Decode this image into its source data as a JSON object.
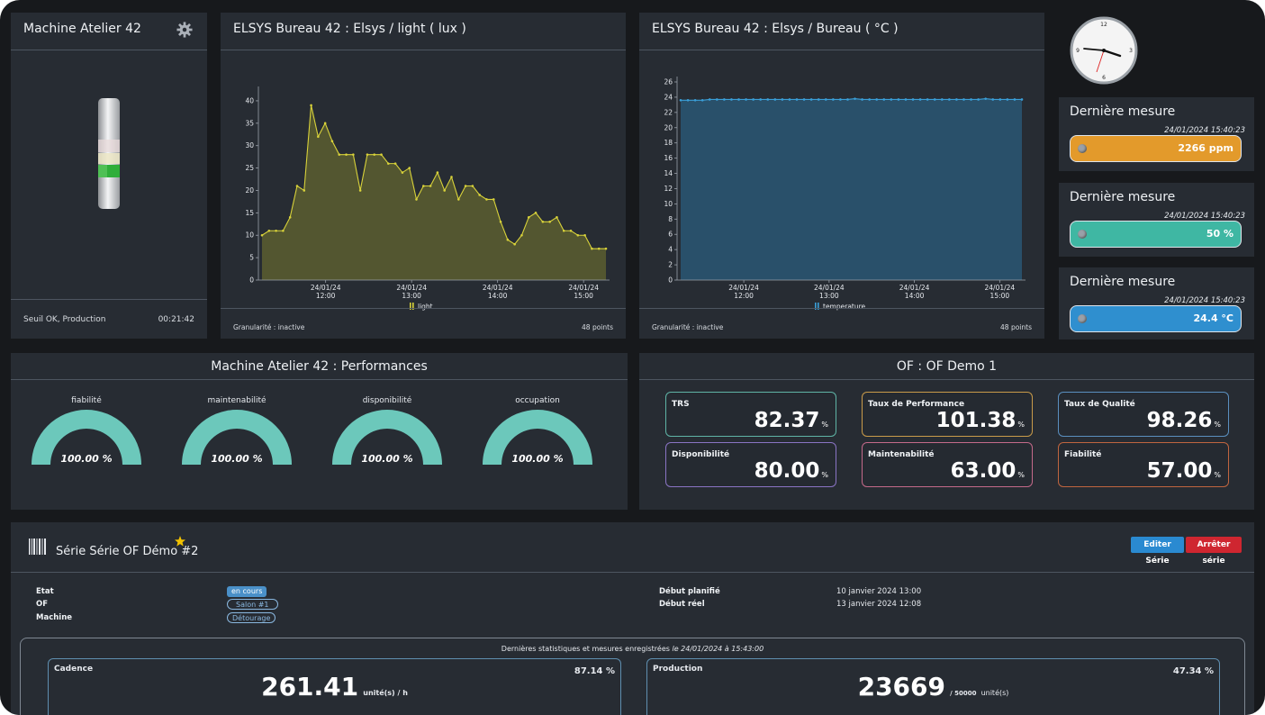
{
  "machine_panel": {
    "title": "Machine Atelier 42",
    "status": "Seuil OK, Production",
    "timer": "00:21:42"
  },
  "light_chart": {
    "title": "ELSYS Bureau 42 : Elsys / light ( lux  )",
    "granularity": "Granularité : inactive",
    "points": "48 points",
    "legend": "light",
    "tick_labels": {
      "y": [
        "0",
        "5",
        "10",
        "15",
        "20",
        "25",
        "30",
        "35",
        "40"
      ],
      "x_dates": [
        "24/01/24",
        "24/01/24",
        "24/01/24",
        "24/01/24"
      ],
      "x_times": [
        "12:00",
        "13:00",
        "14:00",
        "15:00"
      ]
    }
  },
  "temp_chart": {
    "title": "ELSYS Bureau 42 : Elsys / Bureau ( °C  )",
    "granularity": "Granularité : inactive",
    "points": "48 points",
    "legend": "temperature",
    "tick_labels": {
      "y": [
        "0",
        "2",
        "4",
        "6",
        "8",
        "10",
        "12",
        "14",
        "16",
        "18",
        "20",
        "22",
        "24",
        "26"
      ],
      "x_dates": [
        "24/01/24",
        "24/01/24",
        "24/01/24",
        "24/01/24"
      ],
      "x_times": [
        "12:00",
        "13:00",
        "14:00",
        "15:00"
      ]
    }
  },
  "clock": {
    "numerals": [
      "12",
      "3",
      "6",
      "9"
    ],
    "time": "15:40"
  },
  "measures": [
    {
      "title": "Dernière mesure",
      "date": "24/01/2024 15:40:23",
      "value": "2266 ppm",
      "color": "#e39a2b"
    },
    {
      "title": "Dernière mesure",
      "date": "24/01/2024 15:40:23",
      "value": "50 %",
      "color": "#3fb7a3"
    },
    {
      "title": "Dernière mesure",
      "date": "24/01/2024 15:40:23",
      "value": "24.4 °C",
      "color": "#2f8fcf"
    }
  ],
  "performances": {
    "title": "Machine Atelier 42 : Performances",
    "gauges": [
      {
        "label": "fiabilité",
        "value": "100.00 %",
        "level": 1.0
      },
      {
        "label": "maintenabilité",
        "value": "100.00 %",
        "level": 1.0
      },
      {
        "label": "disponibilité",
        "value": "100.00 %",
        "level": 1.0
      },
      {
        "label": "occupation",
        "value": "100.00 %",
        "level": 1.0
      }
    ],
    "gauge_color": "#6cc8bb"
  },
  "of_panel": {
    "title": "OF : OF Demo 1",
    "kpis": [
      {
        "label": "TRS",
        "value": "82.37",
        "unit": "%",
        "border": "#5fb4a6"
      },
      {
        "label": "Taux de Performance",
        "value": "101.38",
        "unit": "%",
        "border": "#c99b4a"
      },
      {
        "label": "Taux de Qualité",
        "value": "98.26",
        "unit": "%",
        "border": "#5a8fbf"
      },
      {
        "label": "Disponibilité",
        "value": "80.00",
        "unit": "%",
        "border": "#8a74c4"
      },
      {
        "label": "Maintenabilité",
        "value": "63.00",
        "unit": "%",
        "border": "#c46a8a"
      },
      {
        "label": "Fiabilité",
        "value": "57.00",
        "unit": "%",
        "border": "#c0653f"
      }
    ]
  },
  "serie": {
    "title": "Série Série OF Démo #2",
    "edit_btn": "Editer Série",
    "stop_btn": "Arrêter série",
    "etat_label": "Etat",
    "etat_value": "en cours",
    "of_label": "OF",
    "of_value": "Salon #1",
    "machine_label": "Machine",
    "machine_value": "Détourage",
    "debut_planifie_label": "Début planifié",
    "debut_planifie_value": "10 janvier 2024 13:00",
    "debut_reel_label": "Début réel",
    "debut_reel_value": "13 janvier 2024 12:08",
    "stats_title": "Dernières statistiques et mesures enregistrées",
    "stats_date": "le 24/01/2024 à 15:43:00",
    "cadence_label": "Cadence",
    "cadence_pct": "87.14 %",
    "cadence_value": "261.41",
    "cadence_unit": "unité(s) / h",
    "production_label": "Production",
    "production_pct": "47.34 %",
    "production_value": "23669",
    "production_total": "/ 50000",
    "production_unit": "unité(s)"
  },
  "chart_data": [
    {
      "type": "area",
      "title": "ELSYS Bureau 42 : Elsys / light ( lux  )",
      "series": [
        {
          "name": "light",
          "color": "#d8d23a",
          "values": [
            10,
            11,
            11,
            11,
            14,
            21,
            20,
            39,
            32,
            35,
            31,
            28,
            28,
            28,
            20,
            28,
            28,
            28,
            26,
            26,
            24,
            25,
            18,
            21,
            21,
            24,
            20,
            23,
            18,
            21,
            21,
            19,
            18,
            18,
            13,
            9,
            8,
            10,
            14,
            15,
            13,
            13,
            14,
            11,
            11,
            10,
            10,
            7,
            7,
            7
          ]
        }
      ],
      "x_range": [
        "24/01/24 11:40",
        "24/01/24 15:40"
      ],
      "ylim": [
        0,
        42
      ],
      "legend": "bottom-center"
    },
    {
      "type": "area",
      "title": "ELSYS Bureau 42 : Elsys / Bureau ( °C  )",
      "series": [
        {
          "name": "temperature",
          "color": "#3a9fd8",
          "values": [
            23.6,
            23.6,
            23.6,
            23.6,
            23.7,
            23.7,
            23.7,
            23.7,
            23.7,
            23.7,
            23.7,
            23.7,
            23.7,
            23.7,
            23.7,
            23.7,
            23.7,
            23.7,
            23.7,
            23.7,
            23.7,
            23.7,
            23.7,
            23.7,
            23.8,
            23.7,
            23.7,
            23.7,
            23.7,
            23.7,
            23.7,
            23.7,
            23.7,
            23.7,
            23.7,
            23.7,
            23.7,
            23.7,
            23.7,
            23.7,
            23.7,
            23.7,
            23.8,
            23.7,
            23.7,
            23.7,
            23.7,
            23.7
          ]
        }
      ],
      "x_range": [
        "24/01/24 11:40",
        "24/01/24 15:40"
      ],
      "ylim": [
        0,
        26
      ],
      "legend": "bottom-center"
    }
  ]
}
